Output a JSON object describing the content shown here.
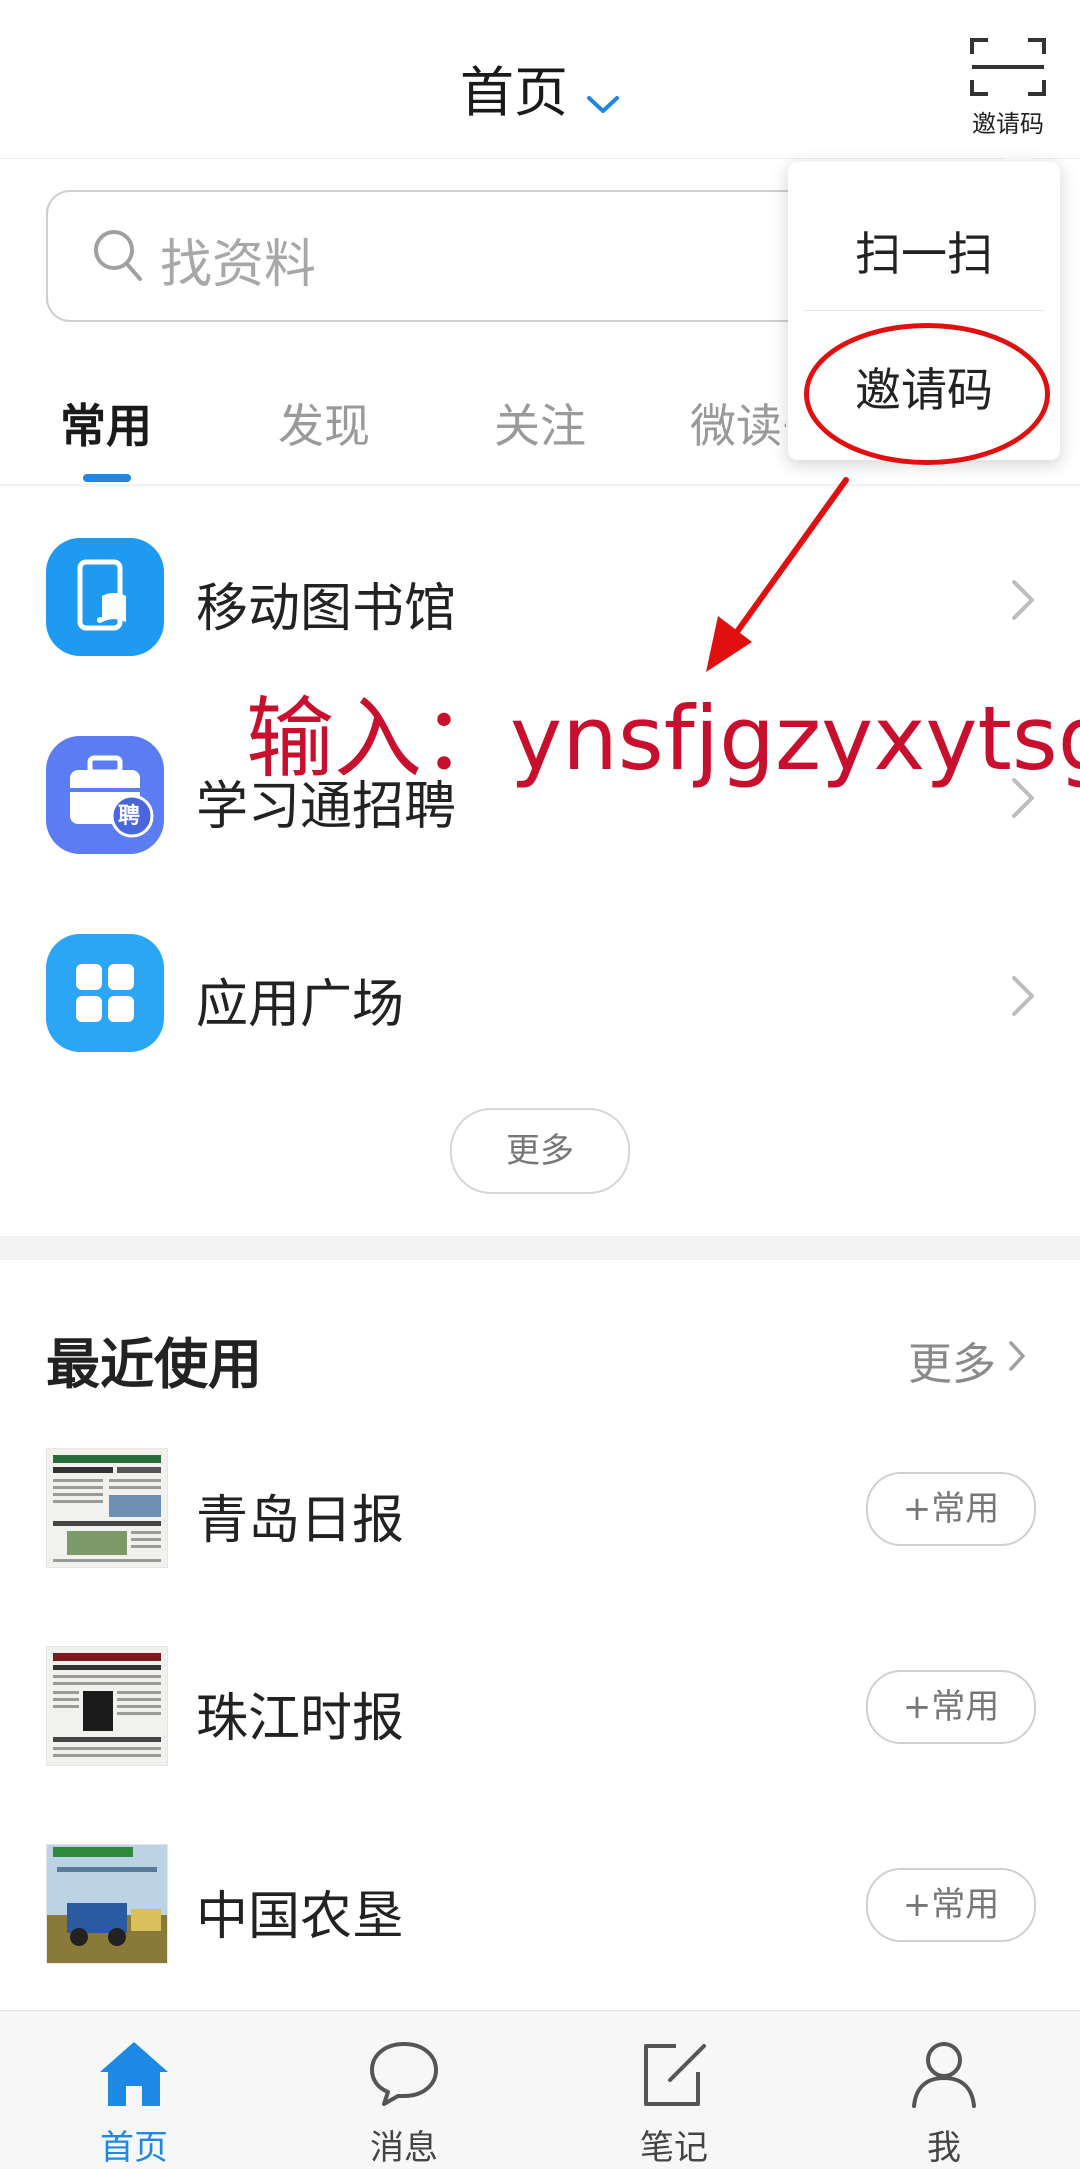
{
  "header": {
    "title": "首页",
    "scan_label": "邀请码"
  },
  "search": {
    "placeholder": "找资料"
  },
  "tabs": [
    {
      "label": "常用",
      "active": true
    },
    {
      "label": "发现",
      "active": false
    },
    {
      "label": "关注",
      "active": false
    },
    {
      "label": "微读书",
      "active": false
    }
  ],
  "common_list": [
    {
      "label": "移动图书馆",
      "icon": "mobile-library-icon",
      "color": "#1e9bf0"
    },
    {
      "label": "学习通招聘",
      "icon": "recruitment-briefcase-icon",
      "color": "#5b7cf2",
      "badge": "聘"
    },
    {
      "label": "应用广场",
      "icon": "app-grid-icon",
      "color": "#2aa6f5"
    }
  ],
  "common_more": "更多",
  "recent": {
    "title": "最近使用",
    "more": "更多",
    "items": [
      {
        "label": "青岛日报",
        "add": "+常用"
      },
      {
        "label": "珠江时报",
        "add": "+常用"
      },
      {
        "label": "中国农垦",
        "add": "+常用"
      }
    ]
  },
  "popup": {
    "scan": "扫一扫",
    "invite": "邀请码"
  },
  "annotation": {
    "text": "输入：ynsfjgzyxytsg",
    "color": "#c8102e"
  },
  "nav": [
    {
      "label": "首页",
      "icon": "home-icon",
      "active": true
    },
    {
      "label": "消息",
      "icon": "chat-bubble-icon",
      "active": false
    },
    {
      "label": "笔记",
      "icon": "note-edit-icon",
      "active": false
    },
    {
      "label": "我",
      "icon": "user-icon",
      "active": false
    }
  ],
  "colors": {
    "accent": "#1e88e5",
    "annotation": "#e01010"
  }
}
